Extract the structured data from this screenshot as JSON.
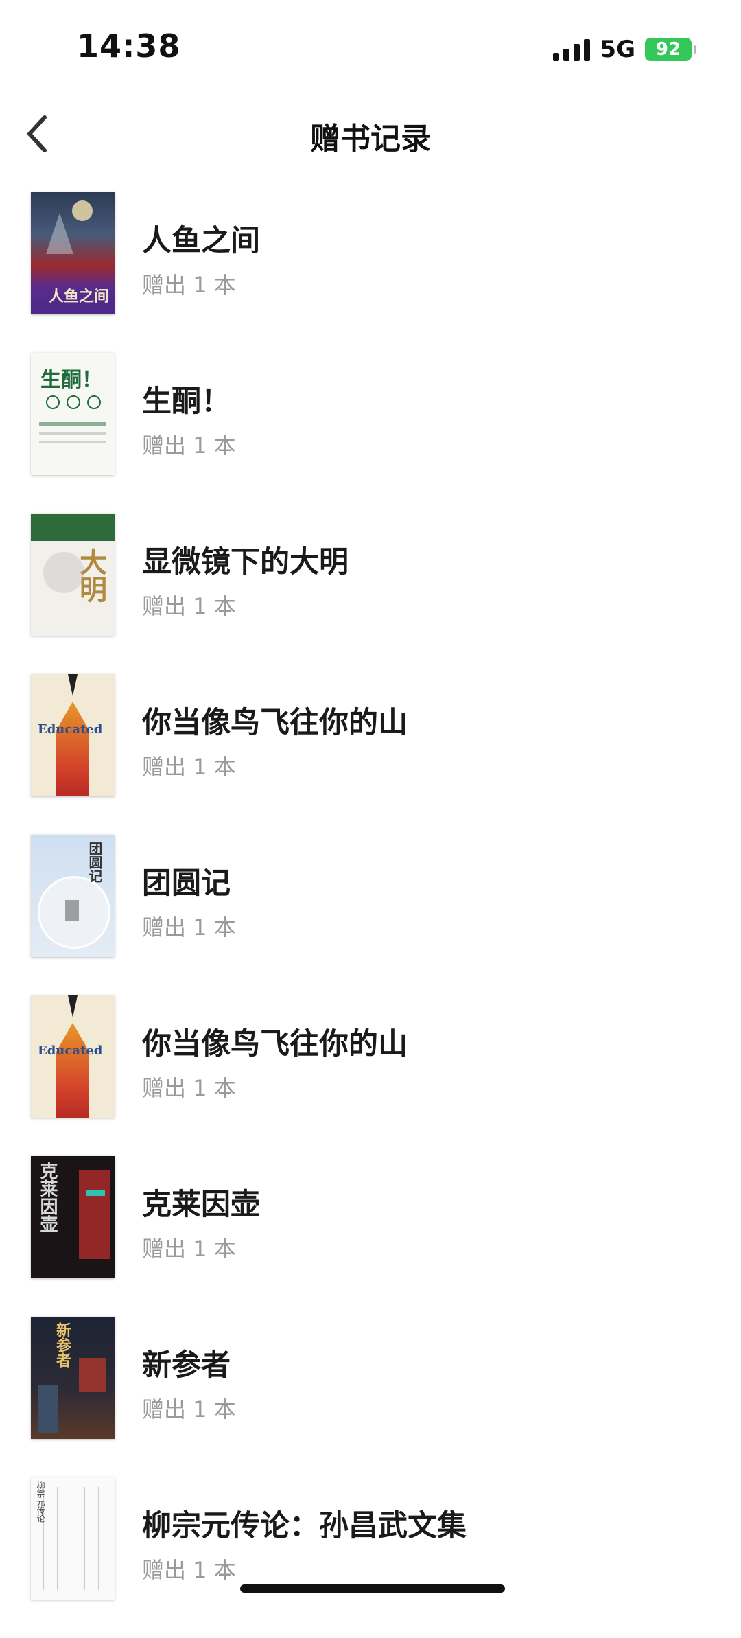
{
  "status_bar": {
    "time": "14:38",
    "network": "5G",
    "battery": "92"
  },
  "nav": {
    "title": "赠书记录",
    "back_icon": "chevron-left-icon"
  },
  "books": [
    {
      "title": "人鱼之间",
      "count": "赠出 1 本",
      "cover_text": "人鱼之间"
    },
    {
      "title": "生酮！",
      "count": "赠出 1 本",
      "cover_text": "生酮！"
    },
    {
      "title": "显微镜下的大明",
      "count": "赠出 1 本",
      "cover_text": "大明"
    },
    {
      "title": "你当像鸟飞往你的山",
      "count": "赠出 1 本",
      "cover_text": "Educated"
    },
    {
      "title": "团圆记",
      "count": "赠出 1 本",
      "cover_text": "团圆记"
    },
    {
      "title": "你当像鸟飞往你的山",
      "count": "赠出 1 本",
      "cover_text": "Educated"
    },
    {
      "title": "克莱因壶",
      "count": "赠出 1 本",
      "cover_text": "克莱因壶"
    },
    {
      "title": "新参者",
      "count": "赠出 1 本",
      "cover_text": "新参者"
    },
    {
      "title": "柳宗元传论：孙昌武文集",
      "count": "赠出 1 本",
      "cover_text": "柳宗元传论"
    }
  ]
}
